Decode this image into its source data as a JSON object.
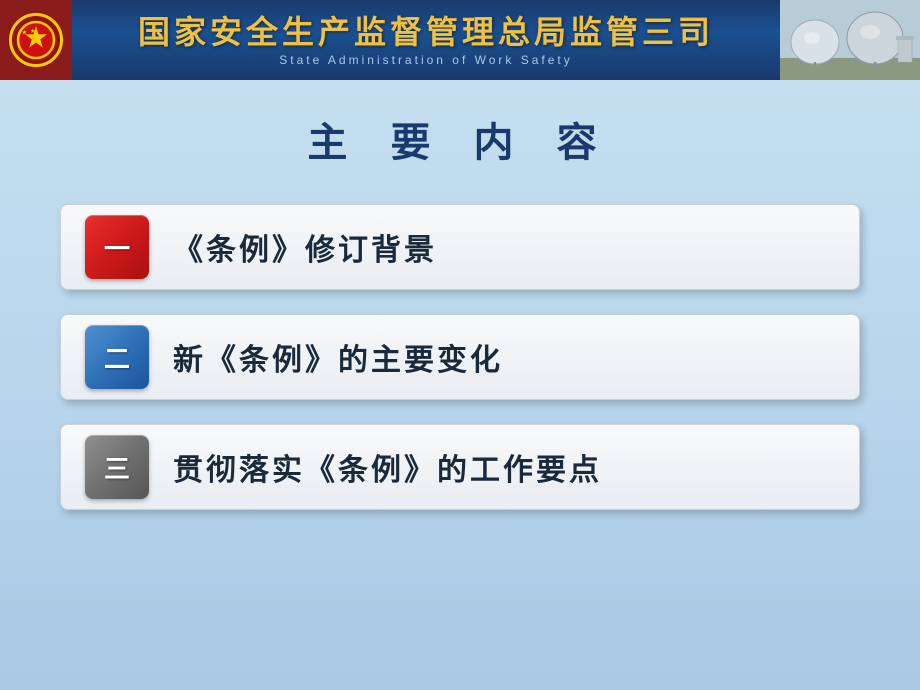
{
  "header": {
    "emblem": "☆",
    "chinese_title": "国家安全生产监督管理总局监管三司",
    "english_title": "State  Administration  of  Work  Safety",
    "left_bg_color": "#7a1010"
  },
  "main": {
    "page_title": "主 要 内 容",
    "menu_items": [
      {
        "id": "item-1",
        "badge_text": "一",
        "badge_class": "badge-red",
        "text": "《条例》修订背景"
      },
      {
        "id": "item-2",
        "badge_text": "二",
        "badge_class": "badge-blue",
        "text": "新《条例》的主要变化"
      },
      {
        "id": "item-3",
        "badge_text": "三",
        "badge_class": "badge-gray",
        "text": "贯彻落实《条例》的工作要点"
      }
    ]
  }
}
